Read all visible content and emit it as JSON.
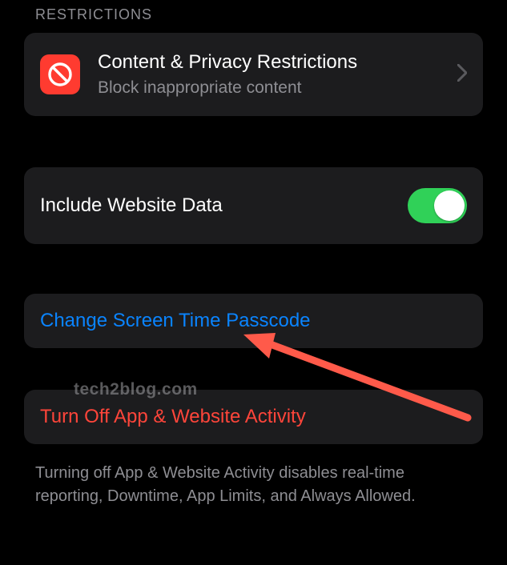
{
  "section_header": "RESTRICTIONS",
  "restrictions": {
    "title": "Content & Privacy Restrictions",
    "subtitle": "Block inappropriate content"
  },
  "website_data": {
    "label": "Include Website Data",
    "enabled": true
  },
  "change_passcode": {
    "label": "Change Screen Time Passcode"
  },
  "turn_off": {
    "label": "Turn Off App & Website Activity"
  },
  "footer": "Turning off App & Website Activity disables real-time reporting, Downtime, App Limits, and Always Allowed.",
  "watermark": "tech2blog.com",
  "colors": {
    "accent_red": "#ff3b30",
    "accent_green": "#30d158",
    "accent_blue": "#0a84ff",
    "cell_bg": "#1c1c1e"
  }
}
